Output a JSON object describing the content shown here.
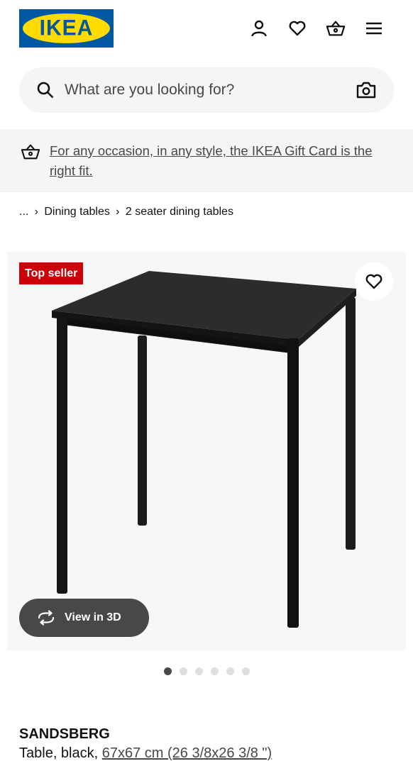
{
  "header": {
    "logo_text": "IKEA",
    "icons": [
      "user-icon",
      "heart-icon",
      "basket-icon",
      "hamburger-menu-icon"
    ]
  },
  "search": {
    "placeholder": "What are you looking for?"
  },
  "promo": {
    "text": "For any occasion, in any style, the IKEA Gift Card is the right fit."
  },
  "breadcrumb": {
    "ellipsis": "...",
    "items": [
      "Dining tables",
      "2 seater dining tables"
    ]
  },
  "gallery": {
    "badge": "Top seller",
    "view3d_label": "View in 3D",
    "image_count": 6,
    "active_index": 0
  },
  "product": {
    "name": "SANDSBERG",
    "description": "Table, black, ",
    "size_link": "67x67 cm (26 3/8x26 3/8 \")"
  },
  "colors": {
    "ikea_blue": "#0058a3",
    "ikea_yellow": "#ffdb00",
    "badge_red": "#cc0008",
    "surface_grey": "#f5f5f5"
  }
}
